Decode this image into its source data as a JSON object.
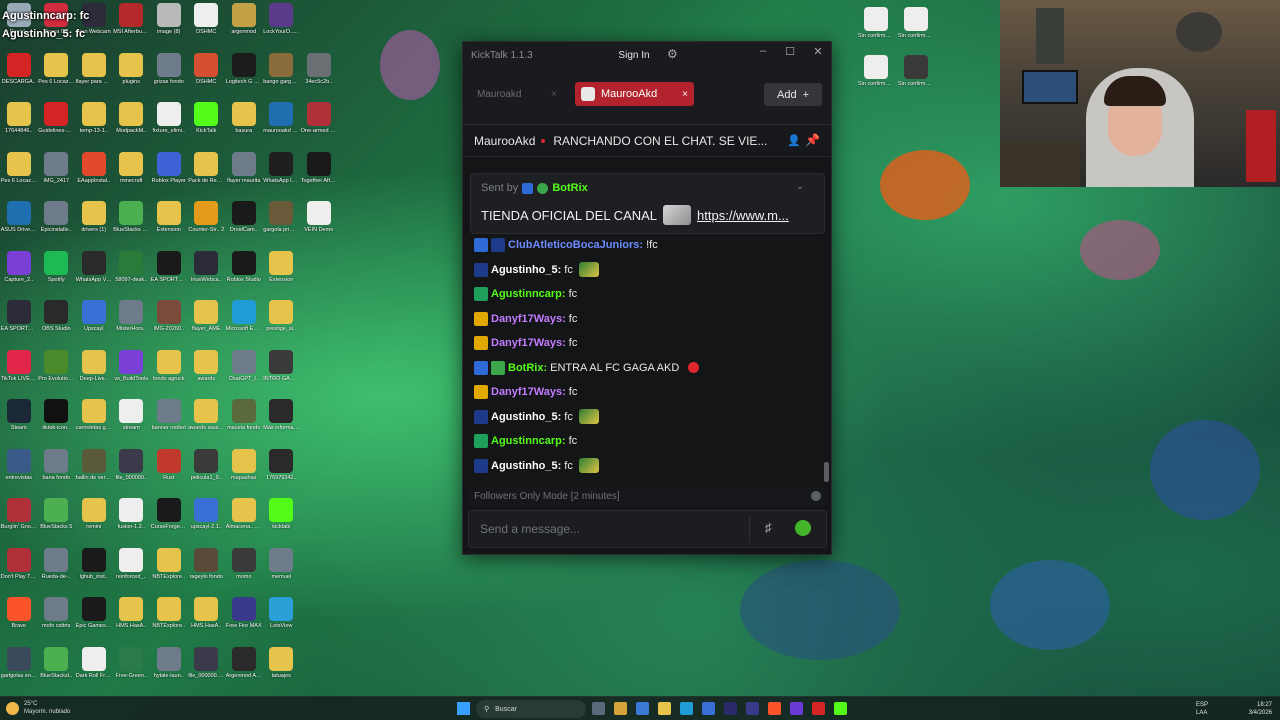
{
  "desktop": {
    "overlay_names": [
      "Agustinncarp: fc",
      "Agustinho_5: fc"
    ],
    "icons": [
      {
        "label": "Recicl..",
        "color": "#9aa9b8"
      },
      {
        "label": "Opera GX",
        "color": "#d12c3f"
      },
      {
        "label": "Iriun Webcam",
        "color": "#2b2b3a"
      },
      {
        "label": "MSI Afterburner",
        "color": "#b42a2a"
      },
      {
        "label": "image (8)",
        "color": "#b9b9b9"
      },
      {
        "label": "DSHMC",
        "color": "#eeeeee"
      },
      {
        "label": "argenmod",
        "color": "#c2a146"
      },
      {
        "label": "LockYourD.. Demo",
        "color": "#5b3a8a"
      },
      {
        "label": "",
        "color": "transparent"
      },
      {
        "label": "DESCARGA..",
        "color": "#d42424"
      },
      {
        "label": "Pes 6 Locazos",
        "color": "#e6c34a"
      },
      {
        "label": "flayer para miguel",
        "color": "#e6c34a"
      },
      {
        "label": "plugins",
        "color": "#e6c34a"
      },
      {
        "label": "grizas fondo",
        "color": "#6d7b8a"
      },
      {
        "label": "DSHMC",
        "color": "#d44f2f"
      },
      {
        "label": "Logitech G HUB",
        "color": "#1c1c1c"
      },
      {
        "label": "bango gargolas",
        "color": "#8a6b3a"
      },
      {
        "label": "34ec5c2b..",
        "color": "#6a6f74"
      },
      {
        "label": "17644846..",
        "color": "#e6c34a"
      },
      {
        "label": "Guidelines-Streams",
        "color": "#d42424"
      },
      {
        "label": "temp-13-1..",
        "color": "#e6c34a"
      },
      {
        "label": "ModpackM..",
        "color": "#e6c34a"
      },
      {
        "label": "fixture_elimi..",
        "color": "#eeeeee"
      },
      {
        "label": "KickTalk",
        "color": "#53fc18"
      },
      {
        "label": "basura",
        "color": "#e6c34a"
      },
      {
        "label": "maurooakd code",
        "color": "#1f6fb0"
      },
      {
        "label": "One-armed robber",
        "color": "#b0303a"
      },
      {
        "label": "Pes 6 Locazos",
        "color": "#e6c34a"
      },
      {
        "label": "IMG_2417",
        "color": "#6d7b8a"
      },
      {
        "label": "EAappInstal..",
        "color": "#e24a2b"
      },
      {
        "label": "minecraft",
        "color": "#e6c34a"
      },
      {
        "label": "Roblox Player",
        "color": "#3f61d6"
      },
      {
        "label": "Pack de Recursos -",
        "color": "#e6c34a"
      },
      {
        "label": "flayer maurita",
        "color": "#6d7b8a"
      },
      {
        "label": "WhatsApp Image 2026..",
        "color": "#1f1f1f"
      },
      {
        "label": "Together After Dark",
        "color": "#1a1a1a"
      },
      {
        "label": "ASUS DriverHub",
        "color": "#1f6fb0"
      },
      {
        "label": "Epicinstalle..",
        "color": "#6d7b8a"
      },
      {
        "label": "drivers (1)",
        "color": "#e6c34a"
      },
      {
        "label": "BlueStacks Multi-Insta..",
        "color": "#4caf50"
      },
      {
        "label": "Extension",
        "color": "#e6c34a"
      },
      {
        "label": "Counter-Str.. 2",
        "color": "#e49b1b"
      },
      {
        "label": "DroidCam..",
        "color": "#1a1a1a"
      },
      {
        "label": "gargola primer e..",
        "color": "#6b5a3a"
      },
      {
        "label": "VEIN Demo",
        "color": "#eeeeee"
      },
      {
        "label": "Capture_2..",
        "color": "#7b3fd6"
      },
      {
        "label": "Spotify",
        "color": "#1db954"
      },
      {
        "label": "WhatsApp Video 2025-",
        "color": "#2a2a2a"
      },
      {
        "label": "58097-desk..",
        "color": "#2a7a3a"
      },
      {
        "label": "EA SPORTS FC 26",
        "color": "#1a1a1a"
      },
      {
        "label": "IriunWebca..",
        "color": "#2b2b3a"
      },
      {
        "label": "Roblox Studio",
        "color": "#1a1a1a"
      },
      {
        "label": "Extension",
        "color": "#e6c34a"
      },
      {
        "label": "",
        "color": "transparent"
      },
      {
        "label": "EA SPORTS FC 26",
        "color": "#2b2b3a"
      },
      {
        "label": "OBS Studio",
        "color": "#2a2a2a"
      },
      {
        "label": "Upscayl",
        "color": "#3a6fd6"
      },
      {
        "label": "MisterHors..",
        "color": "#6d7b8a"
      },
      {
        "label": "IMG-20260..",
        "color": "#7a4a3a"
      },
      {
        "label": "flayer_AME",
        "color": "#e6c34a"
      },
      {
        "label": "Microsoft Edge",
        "color": "#1f9bd6"
      },
      {
        "label": "prestige_si..",
        "color": "#e6c34a"
      },
      {
        "label": "",
        "color": "transparent"
      },
      {
        "label": "TikTok LIVE Studio",
        "color": "#e2264a"
      },
      {
        "label": "Pro Evolution Soccer 6",
        "color": "#4a8a2a"
      },
      {
        "label": "Deep-Live..",
        "color": "#e6c34a"
      },
      {
        "label": "vs_BuildTools",
        "color": "#7a3fd6"
      },
      {
        "label": "fondo agruck",
        "color": "#e6c34a"
      },
      {
        "label": "awards",
        "color": "#e6c34a"
      },
      {
        "label": "ChatGPT_I..",
        "color": "#6d7b8a"
      },
      {
        "label": "INTRO GARGO..",
        "color": "#3a3a3a"
      },
      {
        "label": "",
        "color": "transparent"
      },
      {
        "label": "Steam",
        "color": "#1b2838"
      },
      {
        "label": "tiktok-icon..",
        "color": "#111111"
      },
      {
        "label": "carrioletas gargolas",
        "color": "#e6c34a"
      },
      {
        "label": "stream",
        "color": "#eeeeee"
      },
      {
        "label": "banner roobet",
        "color": "#6d7b8a"
      },
      {
        "label": "awards ssss.ae..",
        "color": "#e6c34a"
      },
      {
        "label": "maceta fondo",
        "color": "#5a6a3a"
      },
      {
        "label": "Más información..",
        "color": "#2a2a2a"
      },
      {
        "label": "",
        "color": "transparent"
      },
      {
        "label": "entrevistas",
        "color": "#3a5a8a"
      },
      {
        "label": "bana fondo",
        "color": "#6d7b8a"
      },
      {
        "label": "ballin de verdad",
        "color": "#5a5a3a"
      },
      {
        "label": "file_000000..",
        "color": "#3a3a4a"
      },
      {
        "label": "Rust",
        "color": "#c0392b"
      },
      {
        "label": "pelicula1_9..",
        "color": "#3a3a3a"
      },
      {
        "label": "mapashas",
        "color": "#e6c34a"
      },
      {
        "label": "176979342..",
        "color": "#2a2a2a"
      },
      {
        "label": "",
        "color": "transparent"
      },
      {
        "label": "Burglin' Gnom..",
        "color": "#b0303a"
      },
      {
        "label": "BlueStacks 5",
        "color": "#4caf50"
      },
      {
        "label": "remini",
        "color": "#e6c34a"
      },
      {
        "label": "fusion-1.2..",
        "color": "#eeeeee"
      },
      {
        "label": "CurseForge Installer",
        "color": "#1a1a1a"
      },
      {
        "label": "upscayl-2.1..",
        "color": "#3a6fd6"
      },
      {
        "label": "Almacena.. automátic..",
        "color": "#e6c34a"
      },
      {
        "label": "kicktalk",
        "color": "#53fc18"
      },
      {
        "label": "",
        "color": "transparent"
      },
      {
        "label": "Don't Play This Demo",
        "color": "#b0303a"
      },
      {
        "label": "Rueda-de-..",
        "color": "#6d7b8a"
      },
      {
        "label": "lghub_inst..",
        "color": "#1a1a1a"
      },
      {
        "label": "reinforced_..",
        "color": "#eeeeee"
      },
      {
        "label": "NBTExplore..",
        "color": "#e6c34a"
      },
      {
        "label": "rageylo fondo",
        "color": "#5a4a3a"
      },
      {
        "label": "momo",
        "color": "#3a3a3a"
      },
      {
        "label": "memuel",
        "color": "#6d7b8a"
      },
      {
        "label": "",
        "color": "transparent"
      },
      {
        "label": "Brave",
        "color": "#fb542b"
      },
      {
        "label": "mofo csttrts",
        "color": "#6d7b8a"
      },
      {
        "label": "Epic Games Launcher",
        "color": "#1a1a1a"
      },
      {
        "label": "HMS.HasA..",
        "color": "#e6c34a"
      },
      {
        "label": "NBTExplore..",
        "color": "#e6c34a"
      },
      {
        "label": "HMS.HasA..",
        "color": "#e6c34a"
      },
      {
        "label": "Free Fire MAX",
        "color": "#3a3a8a"
      },
      {
        "label": "LetsView",
        "color": "#2aa0d6"
      },
      {
        "label": "",
        "color": "transparent"
      },
      {
        "label": "gartgolas entrevistas",
        "color": "#3a4a5a"
      },
      {
        "label": "BlueStacksI..",
        "color": "#4caf50"
      },
      {
        "label": "Dark Roll Free Kic..",
        "color": "#eeeeee"
      },
      {
        "label": "Free-Green..",
        "color": "#2a7a4a"
      },
      {
        "label": "hytale-laun..",
        "color": "#6d7b8a"
      },
      {
        "label": "file_000000.. (1)",
        "color": "#3a3a4a"
      },
      {
        "label": "Argenmod Auth",
        "color": "#2a2a2a"
      },
      {
        "label": "tatuajes",
        "color": "#e6c34a"
      },
      {
        "label": "",
        "color": "transparent"
      }
    ],
    "right_icons": [
      {
        "label": "Sin confirmar 336672.crd..",
        "color": "#eeeeee"
      },
      {
        "label": "Sin confirmar 462937.crd..",
        "color": "#eeeeee"
      }
    ],
    "right_icons_2": [
      {
        "label": "Sin confirmar 894333.crd..",
        "color": "#eeeeee"
      },
      {
        "label": "Sin confirmar 177051028..",
        "color": "#3a3a3a"
      }
    ]
  },
  "kicktalk": {
    "title": "KickTalk 1.1.3",
    "signin_label": "Sign In",
    "gear_icon": "⚙",
    "minimize": "–",
    "maximize": "☐",
    "close": "✕",
    "tabs": [
      {
        "label": "Mauroakd",
        "active": false
      },
      {
        "label": "MaurooAkd",
        "active": true
      }
    ],
    "tab_close": "×",
    "add_label": "Add",
    "add_icon": "+",
    "channel_name": "MaurooAkd",
    "stream_title": "RANCHANDO CON EL CHAT. SE VIE...",
    "pinned": {
      "sent_by_label": "Sent by",
      "sender": "BotRix",
      "message": "TIENDA OFICIAL DEL CANAL",
      "link": "https://www.m..."
    },
    "messages": [
      {
        "user": "ClubAtleticoBocaJuniors:",
        "text": "!fc",
        "color": "#6c8cff",
        "badges": [
          "#2f6bd6",
          "#1e3a8a"
        ],
        "emote": ""
      },
      {
        "user": "Agustinho_5:",
        "text": "fc",
        "color": "#ffffff",
        "badges": [
          "#1e3a8a"
        ],
        "emote": "green"
      },
      {
        "user": "Agustinncarp:",
        "text": "fc",
        "color": "#53fc18",
        "badges": [
          "#1fa05a"
        ],
        "emote": ""
      },
      {
        "user": "Danyf17Ways:",
        "text": "fc",
        "color": "#c27cff",
        "badges": [
          "#e0a800"
        ],
        "emote": ""
      },
      {
        "user": "Danyf17Ways:",
        "text": "fc",
        "color": "#c27cff",
        "badges": [
          "#e0a800"
        ],
        "emote": ""
      },
      {
        "user": "BotRix:",
        "text": "ENTRA AL FC GAGA AKD",
        "color": "#53fc18",
        "badges": [
          "#2f6bd6",
          "#3aa84a"
        ],
        "emote": "red"
      },
      {
        "user": "Danyf17Ways:",
        "text": "fc",
        "color": "#c27cff",
        "badges": [
          "#e0a800"
        ],
        "emote": ""
      },
      {
        "user": "Agustinho_5:",
        "text": "fc",
        "color": "#ffffff",
        "badges": [
          "#1e3a8a"
        ],
        "emote": "green"
      },
      {
        "user": "Agustinncarp:",
        "text": "fc",
        "color": "#53fc18",
        "badges": [
          "#1fa05a"
        ],
        "emote": ""
      },
      {
        "user": "Agustinho_5:",
        "text": "fc",
        "color": "#ffffff",
        "badges": [
          "#1e3a8a"
        ],
        "emote": "green"
      }
    ],
    "followers_mode": "Followers Only Mode [2 minutes]",
    "input_placeholder": "Send a message..."
  },
  "taskbar": {
    "weather_temp": "25°C",
    "weather_desc": "Mayorm. nublado",
    "search_label": "Buscar",
    "lang": "ESP",
    "lang2": "LAA",
    "time": "18:27",
    "date": "3/4/2026",
    "app_colors": [
      "#5a6a7a",
      "#d6a23a",
      "#3a7ad6",
      "#e6c34a",
      "#1f9bd6",
      "#3a6fd6",
      "#2a2a6a",
      "#3a3a8a",
      "#fb542b",
      "#6a3ad6",
      "#d42424",
      "#53fc18"
    ]
  }
}
